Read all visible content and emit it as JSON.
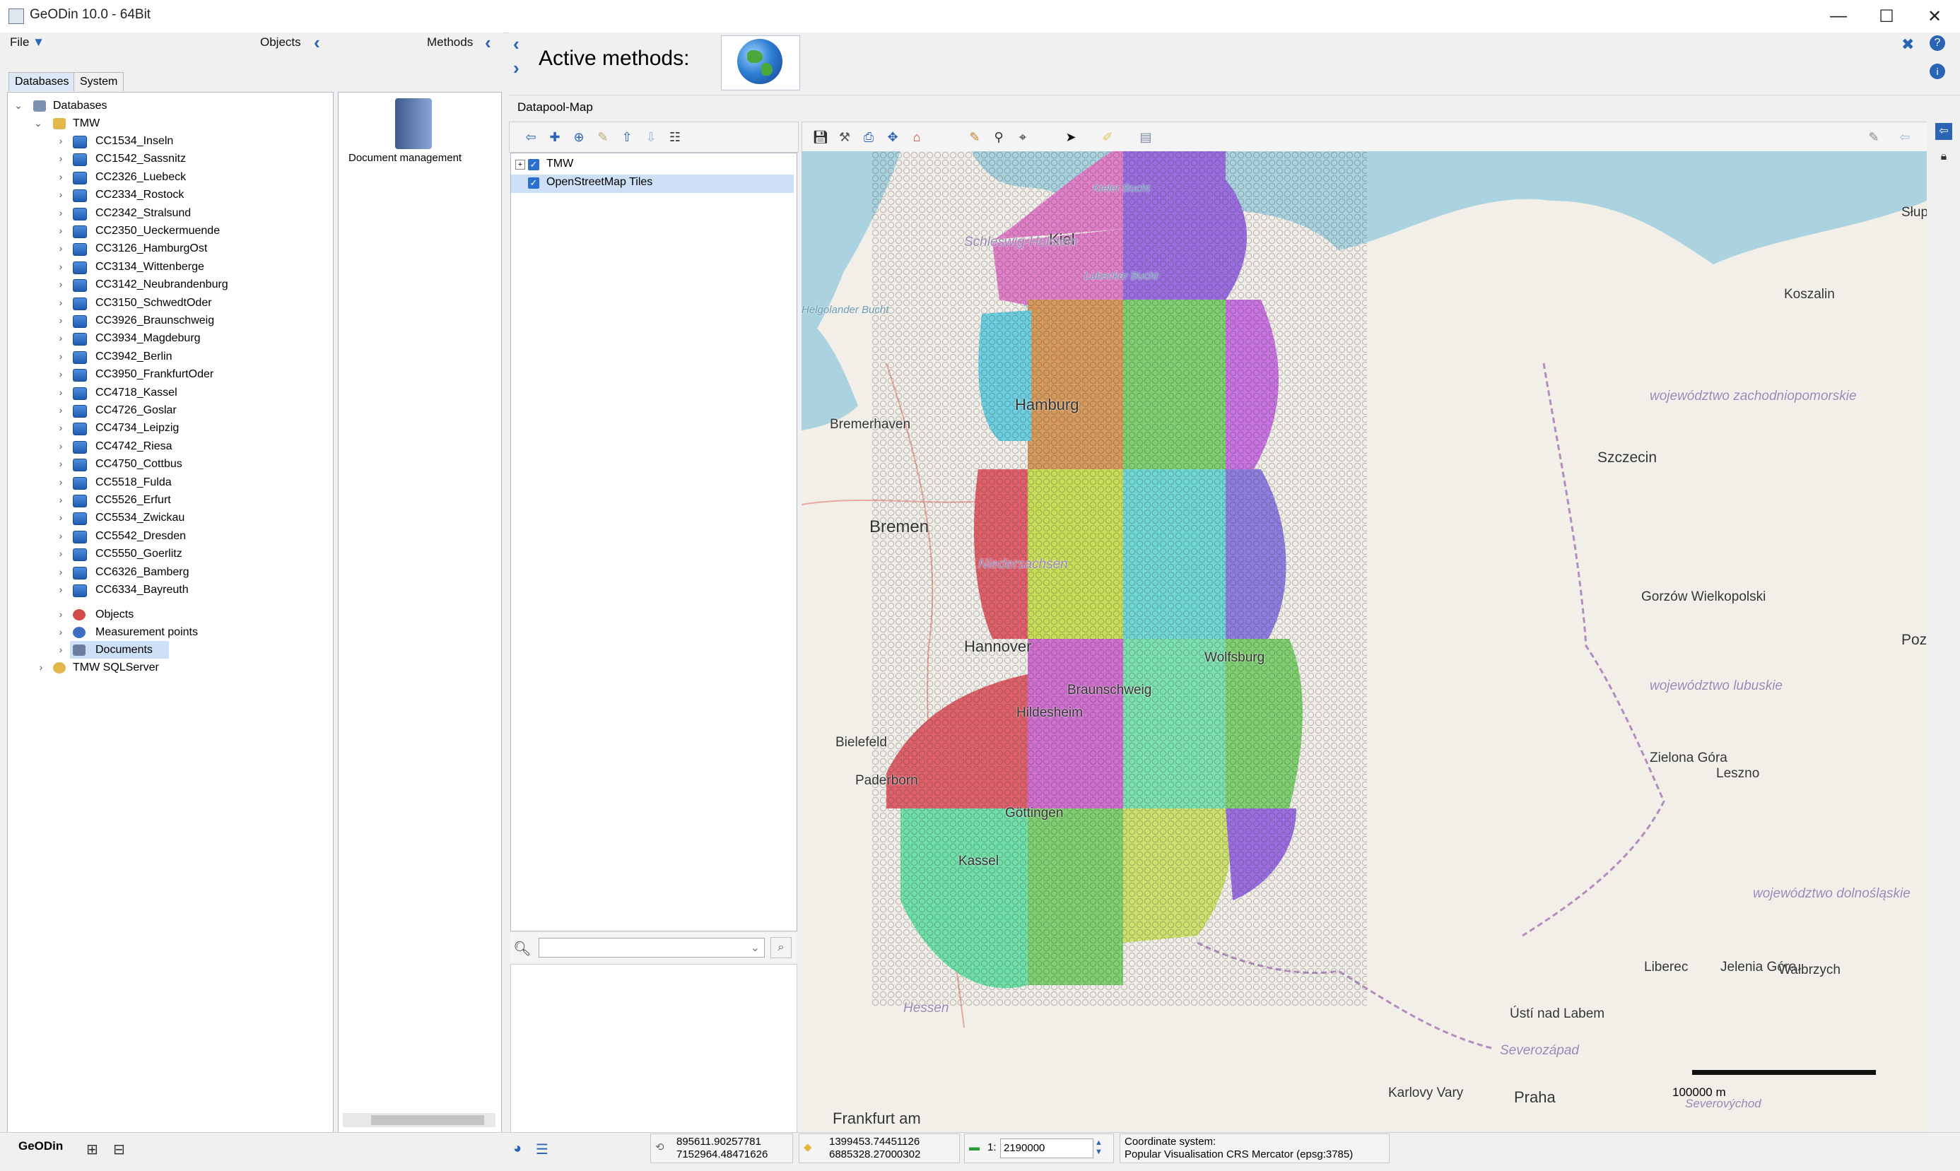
{
  "window": {
    "title": "GeODin 10.0  - 64Bit",
    "minimize": "—",
    "maximize": "☐",
    "close": "✕"
  },
  "menu": {
    "file": "File",
    "objects": "Objects",
    "methods": "Methods"
  },
  "tabs": {
    "databases": "Databases",
    "system": "System"
  },
  "tree": {
    "root": "Databases",
    "project": "TMW",
    "items": [
      "CC1534_Inseln",
      "CC1542_Sassnitz",
      "CC2326_Luebeck",
      "CC2334_Rostock",
      "CC2342_Stralsund",
      "CC2350_Ueckermuende",
      "CC3126_HamburgOst",
      "CC3134_Wittenberge",
      "CC3142_Neubrandenburg",
      "CC3150_SchwedtOder",
      "CC3926_Braunschweig",
      "CC3934_Magdeburg",
      "CC3942_Berlin",
      "CC3950_FrankfurtOder",
      "CC4718_Kassel",
      "CC4726_Goslar",
      "CC4734_Leipzig",
      "CC4742_Riesa",
      "CC4750_Cottbus",
      "CC5518_Fulda",
      "CC5526_Erfurt",
      "CC5534_Zwickau",
      "CC5542_Dresden",
      "CC5550_Goerlitz",
      "CC6326_Bamberg",
      "CC6334_Bayreuth"
    ],
    "objects": "Objects",
    "measurement_points": "Measurement points",
    "documents": "Documents",
    "sqlserver": "TMW SQLServer"
  },
  "method_panel": {
    "document_management": "Document management"
  },
  "active_methods": {
    "label": "Active methods:"
  },
  "datapool": {
    "title": "Datapool-Map"
  },
  "layers": [
    {
      "name": "TMW",
      "checked": true
    },
    {
      "name": "OpenStreetMap Tiles",
      "checked": true
    }
  ],
  "map": {
    "places": [
      {
        "name": "Kieler Bucht",
        "style": "water"
      },
      {
        "name": "Kiel",
        "style": "city"
      },
      {
        "name": "Schleswig-Holstein",
        "style": "region"
      },
      {
        "name": "Lubecker Bucht",
        "style": "water"
      },
      {
        "name": "Helgolander Bucht",
        "style": "water"
      },
      {
        "name": "Hamburg",
        "style": "city"
      },
      {
        "name": "Bremerhaven",
        "style": "town"
      },
      {
        "name": "Bremen",
        "style": "city"
      },
      {
        "name": "Niedersachsen",
        "style": "region"
      },
      {
        "name": "Hannover",
        "style": "city"
      },
      {
        "name": "Braunschweig",
        "style": "town"
      },
      {
        "name": "Hildesheim",
        "style": "town"
      },
      {
        "name": "Bielefeld",
        "style": "town"
      },
      {
        "name": "Paderborn",
        "style": "town"
      },
      {
        "name": "Göttingen",
        "style": "town"
      },
      {
        "name": "Kassel",
        "style": "town"
      },
      {
        "name": "Hessen",
        "style": "region"
      },
      {
        "name": "Frankfurt am",
        "style": "city"
      },
      {
        "name": "Koszalin",
        "style": "town"
      },
      {
        "name": "województwo zachodniopomorskie",
        "style": "region"
      },
      {
        "name": "Gorzów Wielkopolski",
        "style": "town"
      },
      {
        "name": "województwo lubuskie",
        "style": "region"
      },
      {
        "name": "Zielona Góra",
        "style": "town"
      },
      {
        "name": "Leszno",
        "style": "town"
      },
      {
        "name": "województwo dolnośląskie",
        "style": "region"
      },
      {
        "name": "Liberec",
        "style": "town"
      },
      {
        "name": "Jelenia Góra",
        "style": "town"
      },
      {
        "name": "Wałbrzych",
        "style": "town"
      },
      {
        "name": "Ústí nad Labem",
        "style": "town"
      },
      {
        "name": "Severozápad",
        "style": "region"
      },
      {
        "name": "Karlovy Vary",
        "style": "town"
      },
      {
        "name": "Praha",
        "style": "city"
      },
      {
        "name": "Poznań",
        "style": "city"
      },
      {
        "name": "Słupsk",
        "style": "town"
      },
      {
        "name": "Szczecin",
        "style": "city"
      },
      {
        "name": "Wolfsburg",
        "style": "town"
      }
    ],
    "scale_bar": "100000 m",
    "scale_region": "Severovýchod"
  },
  "status": {
    "app": "GeODin",
    "xy1_x": "895611.90257781",
    "xy1_y": "7152964.48471626",
    "xy2_x": "1399453.74451126",
    "xy2_y": "6885328.27000302",
    "scale_prefix": "1:",
    "scale": "2190000",
    "crs_label": "Coordinate system:",
    "crs_value": "Popular Visualisation CRS Mercator (epsg:3785)"
  },
  "colors": {
    "accent": "#2b63b5",
    "sheet_a": "#e27fc9",
    "sheet_b": "#9a6ee0",
    "sheet_c": "#d89a5c",
    "sheet_d": "#7fd070",
    "sheet_e": "#c8de58",
    "sheet_f": "#6fd8d4",
    "sheet_g": "#e0606a",
    "sheet_h": "#6ee0a8"
  }
}
